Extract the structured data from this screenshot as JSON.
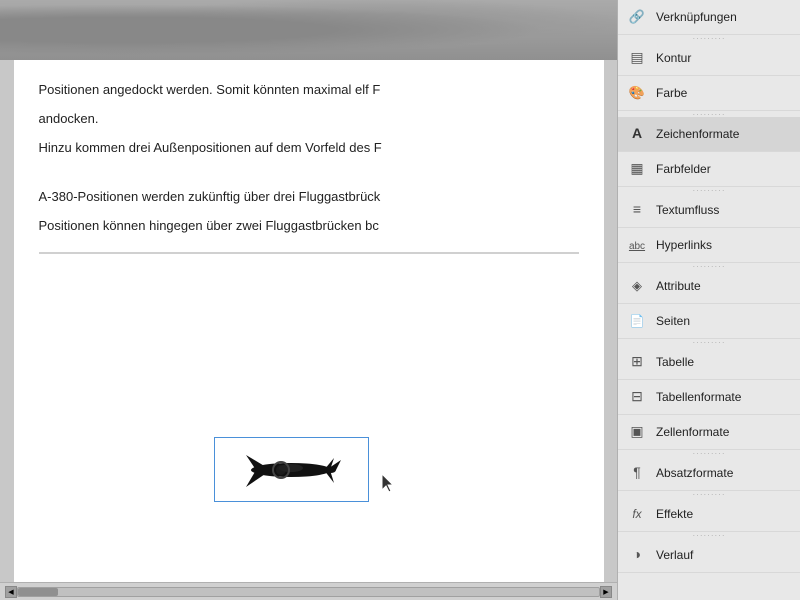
{
  "main": {
    "image_bg": "top image area",
    "paragraphs": [
      "Positionen angedockt werden. Somit könnten maximal elf F",
      "andocken.",
      "Hinzu kommen drei Außenpositionen auf dem Vorfeld des F",
      "",
      "A-380-Positionen werden zukünftig über drei Fluggastbrück",
      "Positionen können hingegen über zwei Fluggastbrücken bc"
    ]
  },
  "scrollbar": {
    "left_arrow": "◀",
    "right_arrow": "▶"
  },
  "panel": {
    "items": [
      {
        "id": "verknuepfungen",
        "label": "Verknüpfungen",
        "icon": "chain"
      },
      {
        "id": "kontur",
        "label": "Kontur",
        "icon": "contour"
      },
      {
        "id": "farbe",
        "label": "Farbe",
        "icon": "color"
      },
      {
        "id": "zeichenformate",
        "label": "Zeichenformate",
        "icon": "charformat",
        "active": true
      },
      {
        "id": "farbfelder",
        "label": "Farbfelder",
        "icon": "colorfield"
      },
      {
        "id": "textumfluss",
        "label": "Textumfluss",
        "icon": "textflow"
      },
      {
        "id": "hyperlinks",
        "label": "Hyperlinks",
        "icon": "hyperlink"
      },
      {
        "id": "attribute",
        "label": "Attribute",
        "icon": "attribute"
      },
      {
        "id": "seiten",
        "label": "Seiten",
        "icon": "pages"
      },
      {
        "id": "tabelle",
        "label": "Tabelle",
        "icon": "table"
      },
      {
        "id": "tabellenformate",
        "label": "Tabellenformate",
        "icon": "tableformat"
      },
      {
        "id": "zellenformate",
        "label": "Zellenformate",
        "icon": "cellformat"
      },
      {
        "id": "absatzformate",
        "label": "Absatzformate",
        "icon": "paraformat"
      },
      {
        "id": "effekte",
        "label": "Effekte",
        "icon": "effects"
      },
      {
        "id": "verlauf",
        "label": "Verlauf",
        "icon": "gradient"
      }
    ]
  }
}
